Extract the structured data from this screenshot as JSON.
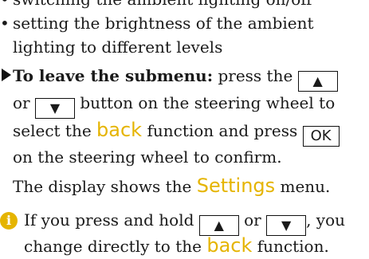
{
  "bullets": [
    "switching the ambient lighting on/off",
    "setting the brightness of the ambient",
    "lighting to different levels"
  ],
  "step": {
    "lead": "To leave the submenu:",
    "part1": " press the ",
    "or": "or ",
    "part2": " button on the steering wheel to",
    "part3": "select the ",
    "back": "back",
    "part4": " function and press ",
    "ok": "OK",
    "part5": "on the steering wheel to confirm."
  },
  "display": {
    "pre": "The display shows the ",
    "settings": "Settings",
    "post": " menu."
  },
  "note": {
    "icon": "i",
    "pre": "If you press and hold ",
    "or": " or ",
    "post": ", you",
    "line2_pre": "change directly to the ",
    "back": "back",
    "line2_post": " function."
  },
  "keys": {
    "up": "▲",
    "down": "▼"
  }
}
